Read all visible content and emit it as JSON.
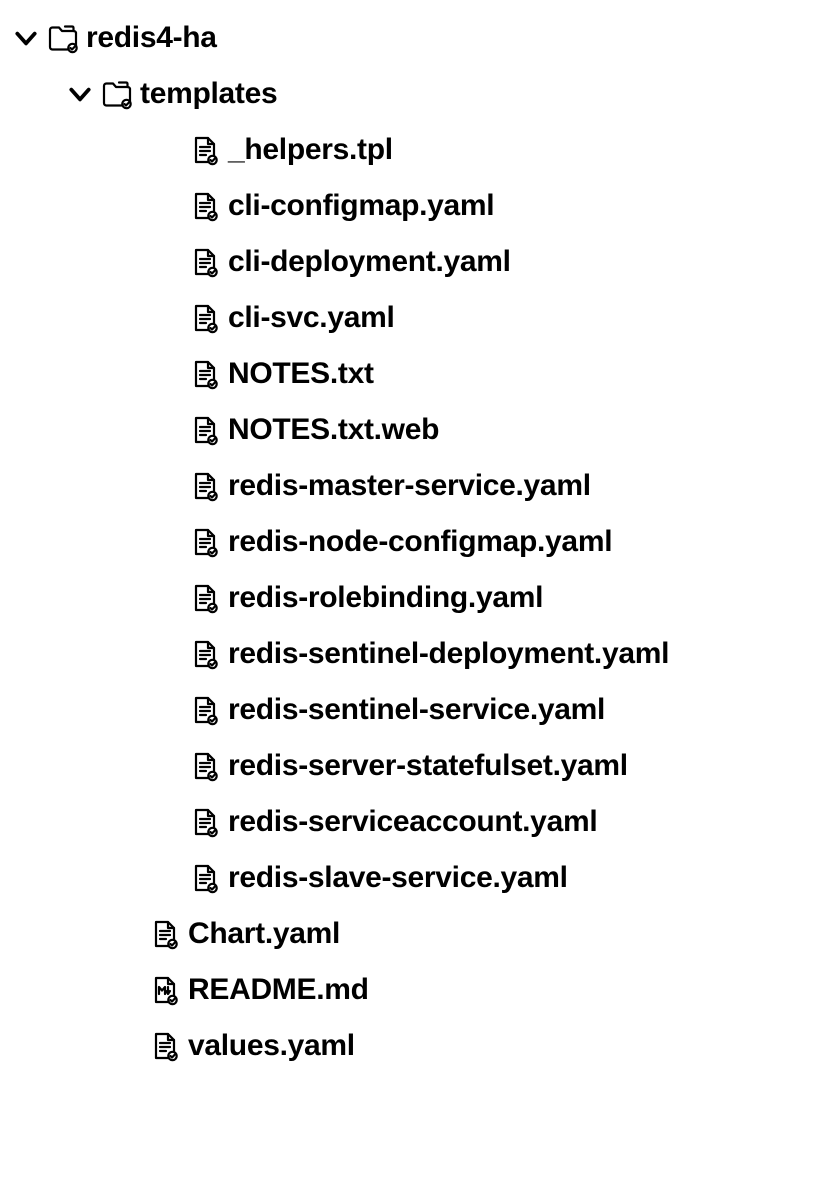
{
  "tree": [
    {
      "id": "f0",
      "type": "folder",
      "name": "redis4-ha",
      "depth": 0,
      "expanded": true
    },
    {
      "id": "f1",
      "type": "folder",
      "name": "templates",
      "depth": 1,
      "expanded": true
    },
    {
      "id": "n0",
      "type": "file",
      "name": "_helpers.tpl",
      "depth": 2,
      "icon": "file"
    },
    {
      "id": "n1",
      "type": "file",
      "name": "cli-configmap.yaml",
      "depth": 2,
      "icon": "file"
    },
    {
      "id": "n2",
      "type": "file",
      "name": "cli-deployment.yaml",
      "depth": 2,
      "icon": "file"
    },
    {
      "id": "n3",
      "type": "file",
      "name": "cli-svc.yaml",
      "depth": 2,
      "icon": "file"
    },
    {
      "id": "n4",
      "type": "file",
      "name": "NOTES.txt",
      "depth": 2,
      "icon": "file"
    },
    {
      "id": "n5",
      "type": "file",
      "name": "NOTES.txt.web",
      "depth": 2,
      "icon": "file"
    },
    {
      "id": "n6",
      "type": "file",
      "name": "redis-master-service.yaml",
      "depth": 2,
      "icon": "file"
    },
    {
      "id": "n7",
      "type": "file",
      "name": "redis-node-configmap.yaml",
      "depth": 2,
      "icon": "file"
    },
    {
      "id": "n8",
      "type": "file",
      "name": "redis-rolebinding.yaml",
      "depth": 2,
      "icon": "file"
    },
    {
      "id": "n9",
      "type": "file",
      "name": "redis-sentinel-deployment.yaml",
      "depth": 2,
      "icon": "file"
    },
    {
      "id": "n10",
      "type": "file",
      "name": "redis-sentinel-service.yaml",
      "depth": 2,
      "icon": "file"
    },
    {
      "id": "n11",
      "type": "file",
      "name": "redis-server-statefulset.yaml",
      "depth": 2,
      "icon": "file"
    },
    {
      "id": "n12",
      "type": "file",
      "name": "redis-serviceaccount.yaml",
      "depth": 2,
      "icon": "file"
    },
    {
      "id": "n13",
      "type": "file",
      "name": "redis-slave-service.yaml",
      "depth": 2,
      "icon": "file"
    },
    {
      "id": "n14",
      "type": "file",
      "name": "Chart.yaml",
      "depth": 1,
      "icon": "file"
    },
    {
      "id": "n15",
      "type": "file",
      "name": "README.md",
      "depth": 1,
      "icon": "md"
    },
    {
      "id": "n16",
      "type": "file",
      "name": "values.yaml",
      "depth": 1,
      "icon": "file"
    }
  ]
}
